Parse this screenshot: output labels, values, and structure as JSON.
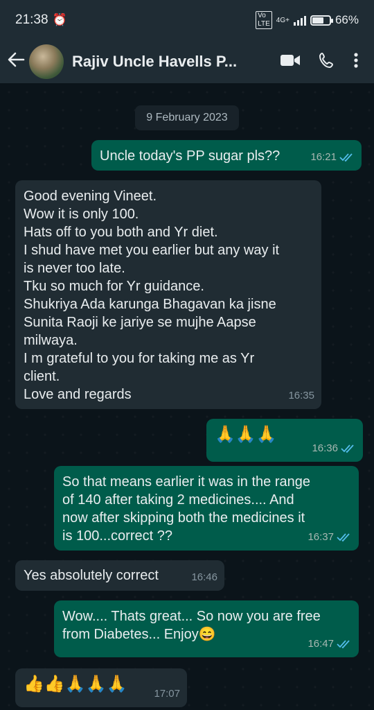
{
  "status_bar": {
    "time": "21:38",
    "alarm_icon": "alarm-clock-icon",
    "network_label": "4G+",
    "battery_percent": "66%",
    "battery_level": 0.66
  },
  "header": {
    "back_icon": "arrow-left-icon",
    "contact_name": "Rajiv Uncle Havells P...",
    "video_icon": "video-camera-icon",
    "call_icon": "phone-icon",
    "menu_icon": "more-vertical-icon"
  },
  "chat": {
    "date_chip": "9 February 2023",
    "messages": [
      {
        "direction": "out",
        "text": "Uncle today's PP sugar pls??",
        "time": "16:21",
        "read": true
      },
      {
        "direction": "in",
        "lines": [
          "Good evening Vineet.",
          "Wow it is only 100.",
          "Hats off to you both and Yr diet.",
          "I shud have met you earlier but any way it",
          "is never too late.",
          "Tku so much for Yr guidance.",
          "Shukriya Ada karunga Bhagavan ka jisne",
          "Sunita Raoji ke jariye se mujhe Aapse",
          "milwaya.",
          "I m grateful to you for taking me as Yr",
          "client.",
          "Love and regards"
        ],
        "time": "16:35"
      },
      {
        "direction": "out",
        "text": "🙏🙏🙏",
        "time": "16:36",
        "read": true
      },
      {
        "direction": "out",
        "lines": [
          "So that means earlier it was in the range",
          "of 140 after taking 2 medicines.... And",
          "now after skipping both the medicines it",
          "is 100...correct ??"
        ],
        "time": "16:37",
        "read": true
      },
      {
        "direction": "in",
        "text": "Yes absolutely correct",
        "time": "16:46"
      },
      {
        "direction": "out",
        "lines": [
          "Wow.... Thats great... So now you are free",
          "from Diabetes... Enjoy😄"
        ],
        "time": "16:47",
        "read": true
      },
      {
        "direction": "in",
        "text": "👍👍🙏🙏🙏",
        "time": "17:07"
      }
    ]
  },
  "colors": {
    "outgoing_bubble": "#005c4b",
    "incoming_bubble": "#202c33",
    "read_tick": "#53bdeb",
    "background": "#0b141a"
  }
}
